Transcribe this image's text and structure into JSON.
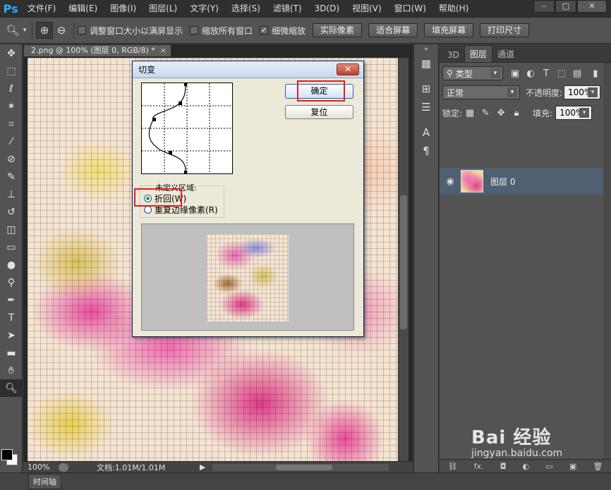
{
  "app": {
    "logo": "Ps"
  },
  "menu": [
    "文件(F)",
    "编辑(E)",
    "图像(I)",
    "图层(L)",
    "文字(Y)",
    "选择(S)",
    "滤镜(T)",
    "3D(D)",
    "视图(V)",
    "窗口(W)",
    "帮助(H)"
  ],
  "window_buttons": {
    "minimize": "–",
    "maximize": "□",
    "close": "✕"
  },
  "options": {
    "resize_window": "调整窗口大小以满屏显示",
    "zoom_all": "缩放所有窗口",
    "scrubby_zoom": "细微缩放",
    "scrubby_checked": true,
    "actual_pixels": "实际像素",
    "fit_screen": "适合屏幕",
    "fill_screen": "填充屏幕",
    "print_size": "打印尺寸"
  },
  "document": {
    "tab_title": "2.png @ 100% (图层 0, RGB/8) *",
    "zoom": "100%",
    "doc_info": "文档:1.01M/1.01M"
  },
  "timeline_label": "时间轴",
  "panel": {
    "tabs": [
      "3D",
      "图层",
      "通道"
    ],
    "active_tab": "图层",
    "filter_type": "类型",
    "blend_mode": "正常",
    "opacity_label": "不透明度:",
    "opacity_value": "100%",
    "lock_label": "锁定:",
    "fill_label": "填充:",
    "fill_value": "100%",
    "layer_name": "图层 0",
    "bottom_icons": [
      "⛓",
      "fx.",
      "◘",
      "◐",
      "▭",
      "▣",
      "🗑"
    ]
  },
  "dialog": {
    "title": "切变",
    "ok_label": "确定",
    "reset_label": "复位",
    "undefined_area_label": "未定义区域:",
    "wrap_around_label": "折回(W)",
    "repeat_edge_label": "重复边缘像素(R)",
    "selected_option": "wrap_around"
  },
  "watermark": {
    "main": "Bai 经验",
    "sub": "jingyan.baidu.com"
  }
}
